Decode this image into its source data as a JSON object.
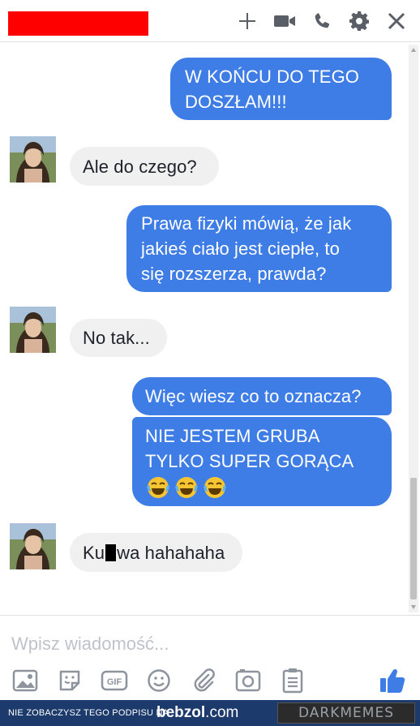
{
  "header": {
    "icons": [
      "add-person-icon",
      "video-call-icon",
      "phone-icon",
      "gear-icon",
      "close-icon"
    ],
    "accent_color": "#3f7de6",
    "redaction_color": "#ff0000"
  },
  "messages": [
    {
      "side": "out",
      "text": "W KOŃCU DO TEGO\nDOSZŁAM!!!"
    },
    {
      "side": "in",
      "text": "Ale do czego?"
    },
    {
      "side": "out",
      "text": "Prawa fizyki mówią, że jak\njakieś ciało jest ciepłe, to\nsię rozszerza, prawda?"
    },
    {
      "side": "in",
      "text": "No tak..."
    },
    {
      "side": "out",
      "text": "Więc wiesz co to oznacza?"
    },
    {
      "side": "out",
      "text": "NIE JESTEM GRUBA\nTYLKO SUPER GORĄCA"
    },
    {
      "side": "in",
      "text_before": "Ku",
      "text_after": "wa hahahaha"
    }
  ],
  "composer": {
    "placeholder": "Wpisz wiadomość...",
    "tools": [
      "image-icon",
      "sticker-icon",
      "gif-icon",
      "emoji-icon",
      "attachment-icon",
      "camera-icon",
      "list-icon"
    ],
    "like_icon": "thumbs-up-icon"
  },
  "footer": {
    "caption": "NIE ZOBACZYSZ TEGO PODPISU NA",
    "site_name": "bebzol",
    "site_tld": ".com",
    "brand": "DARKMEMES"
  }
}
